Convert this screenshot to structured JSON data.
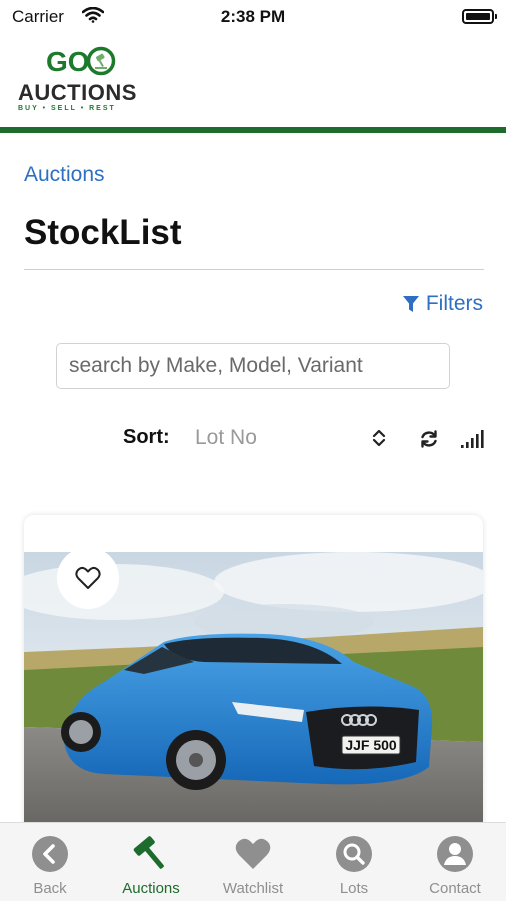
{
  "status_bar": {
    "carrier": "Carrier",
    "time": "2:38 PM"
  },
  "logo": {
    "go": "GO",
    "name": "AUCTIONS",
    "tagline": "BUY • SELL • REST"
  },
  "breadcrumb": "Auctions",
  "page_title": "StockList",
  "filters_label": "Filters",
  "search": {
    "placeholder": "search by Make, Model, Variant",
    "value": ""
  },
  "sort": {
    "label": "Sort:",
    "value": "Lot No"
  },
  "listing": {
    "plate": "JJF 500"
  },
  "tabs": [
    {
      "label": "Back",
      "icon": "back-icon"
    },
    {
      "label": "Auctions",
      "icon": "gavel-icon",
      "active": true
    },
    {
      "label": "Watchlist",
      "icon": "heart-icon"
    },
    {
      "label": "Lots",
      "icon": "search-icon"
    },
    {
      "label": "Contact",
      "icon": "user-icon"
    }
  ],
  "colors": {
    "brand_green": "#1d6b2d",
    "link_blue": "#2e6fc2",
    "tab_inactive": "#8f8f8f"
  }
}
